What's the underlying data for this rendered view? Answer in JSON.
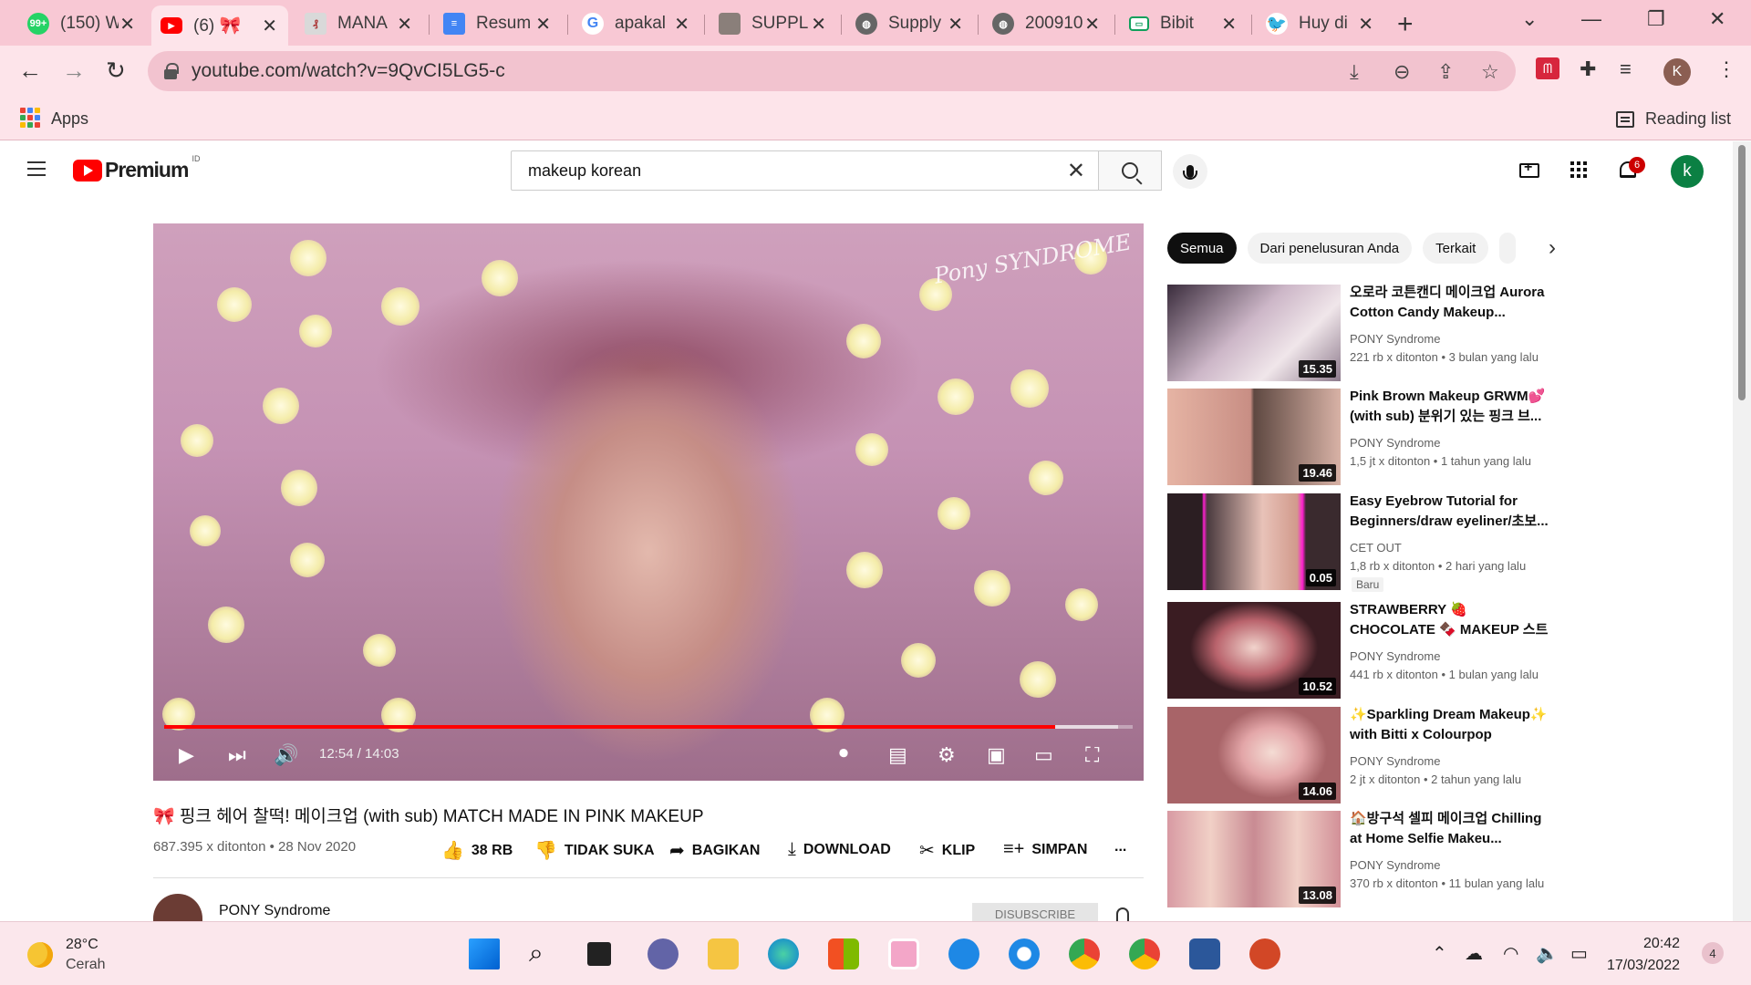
{
  "browser": {
    "tabs": [
      {
        "title": "(150) W",
        "icon": "whatsapp-icon",
        "badge": "99+"
      },
      {
        "title": "(6) 🎀",
        "icon": "youtube-icon",
        "active": true
      },
      {
        "title": "MANA",
        "icon": "document-icon"
      },
      {
        "title": "Resum",
        "icon": "google-docs-icon"
      },
      {
        "title": "apakal",
        "icon": "google-icon"
      },
      {
        "title": "SUPPL",
        "icon": "profile-photo-icon"
      },
      {
        "title": "Supply",
        "icon": "globe-icon"
      },
      {
        "title": "200910",
        "icon": "globe-icon"
      },
      {
        "title": "Bibit",
        "icon": "bibit-icon"
      },
      {
        "title": "Huy di",
        "icon": "twitter-icon"
      }
    ],
    "url": "youtube.com/watch?v=9QvCI5LG5-c",
    "profile_initial": "K",
    "bookmarks": {
      "apps": "Apps",
      "reading_list": "Reading list"
    }
  },
  "youtube": {
    "logo": "Premium",
    "country": "ID",
    "search_query": "makeup korean",
    "notifications": "6",
    "avatar_initial": "k",
    "player": {
      "watermark": "Pony SYNDROME",
      "time": "12:54 / 14:03",
      "progress": 0.92,
      "buffered": 0.985
    },
    "video": {
      "title": "🎀 핑크 헤어 찰떡! 메이크업 (with sub) MATCH MADE IN PINK MAKEUP",
      "meta": "687.395 x ditonton • 28 Nov 2020",
      "actions": {
        "like": "38 RB",
        "dislike": "TIDAK SUKA",
        "share": "BAGIKAN",
        "download": "DOWNLOAD",
        "clip": "KLIP",
        "save": "SIMPAN",
        "more": "..."
      },
      "channel": "PONY Syndrome",
      "subscribe": "DISUBSCRIBE"
    },
    "chips": [
      "Semua",
      "Dari penelusuran Anda",
      "Terkait"
    ],
    "related": [
      {
        "title": "오로라 코튼캔디 메이크업 Aurora Cotton Candy Makeup...",
        "channel": "PONY Syndrome",
        "stats": "221 rb x ditonton • 3 bulan yang lalu",
        "duration": "15.35"
      },
      {
        "title": "Pink Brown Makeup GRWM💕 (with sub) 분위기 있는 핑크 브...",
        "channel": "PONY Syndrome",
        "stats": "1,5 jt x ditonton • 1 tahun yang lalu",
        "duration": "19.46"
      },
      {
        "title": "Easy Eyebrow Tutorial for Beginners/draw eyeliner/초보...",
        "channel": "CET OUT",
        "stats": "1,8 rb x ditonton • 2 hari yang lalu",
        "duration": "0.05",
        "badge": "Baru"
      },
      {
        "title": "STRAWBERRY 🍓 CHOCOLATE 🍫 MAKEUP 스트로베리 초콜...",
        "channel": "PONY Syndrome",
        "stats": "441 rb x ditonton • 1 bulan yang lalu",
        "duration": "10.52"
      },
      {
        "title": "✨Sparkling Dream Makeup✨ with Bitti x Colourpop Collecti...",
        "channel": "PONY Syndrome",
        "stats": "2 jt x ditonton • 2 tahun yang lalu",
        "duration": "14.06"
      },
      {
        "title": "🏠방구석 셀피 메이크업 Chilling at Home Selfie Makeu...",
        "channel": "PONY Syndrome",
        "stats": "370 rb x ditonton • 11 bulan yang lalu",
        "duration": "13.08"
      }
    ]
  },
  "taskbar": {
    "weather_temp": "28°C",
    "weather_cond": "Cerah",
    "time": "20:42",
    "date": "17/03/2022",
    "notifications": "4"
  },
  "colors": {
    "accent_red": "#ff0000",
    "chrome_pink": "#f8c8d4",
    "channel_green": "#0b8043"
  }
}
